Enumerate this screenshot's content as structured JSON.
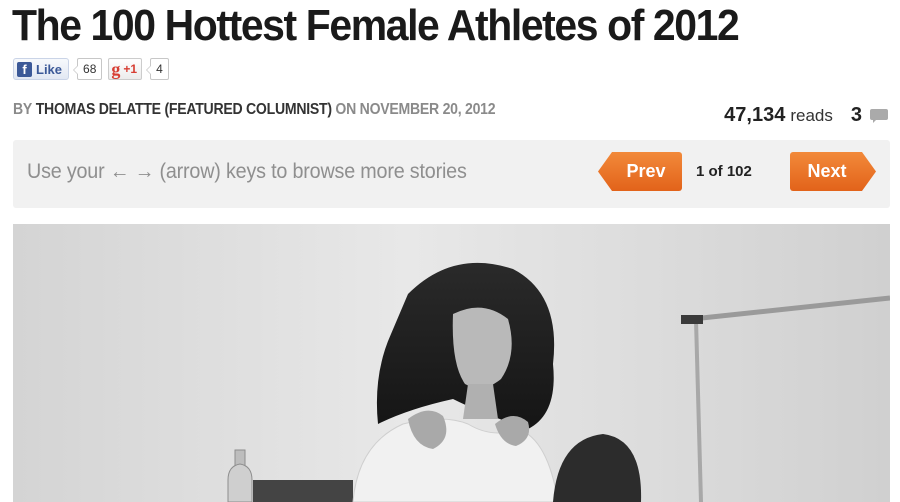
{
  "article": {
    "title": "The 100 Hottest Female Athletes of 2012",
    "byline": {
      "by": "BY",
      "author": "THOMAS DELATTE (FEATURED COLUMNIST)",
      "on": "ON",
      "date": "NOVEMBER 20, 2012"
    },
    "stats": {
      "reads_count": "47,134",
      "reads_label": "reads",
      "comments_count": "3",
      "comment_icon": "comment-icon"
    }
  },
  "social": {
    "facebook": {
      "label": "Like",
      "icon": "facebook-icon",
      "count": "68",
      "color": "#3b5998"
    },
    "google_plus": {
      "label": "+1",
      "icon": "google-plus-icon",
      "count": "4",
      "color": "#d73d32"
    }
  },
  "slideshow_nav": {
    "hint": "Use your ← → (arrow) keys to browse more stories",
    "prev_label": "Prev",
    "next_label": "Next",
    "position": "1 of 102",
    "accent_color": "#e8711f"
  },
  "image": {
    "style": "black-and-white photo"
  }
}
